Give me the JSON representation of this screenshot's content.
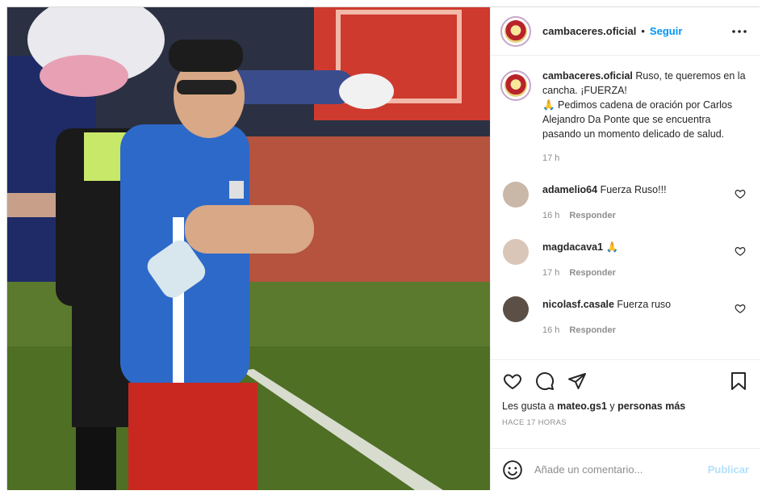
{
  "post": {
    "username": "cambaceres.oficial",
    "separator": "•",
    "follow_label": "Seguir",
    "caption_line1": " Ruso, te queremos en la cancha. ¡FUERZA!",
    "caption_line2": "🙏 Pedimos cadena de oración por Carlos Alejandro Da Ponte que se encuentra pasando un momento delicado de salud.",
    "caption_time": "17 h"
  },
  "comments": [
    {
      "username": "adamelio64",
      "text": " Fuerza Ruso!!!",
      "time": "16 h",
      "reply": "Responder"
    },
    {
      "username": "magdacava1",
      "text": " 🙏",
      "time": "17 h",
      "reply": "Responder"
    },
    {
      "username": "nicolasf.casale",
      "text": " Fuerza ruso",
      "time": "16 h",
      "reply": "Responder"
    }
  ],
  "likes": {
    "prefix": "Les gusta a ",
    "user": "mateo.gs1",
    "middle": " y ",
    "others": "personas más"
  },
  "date_label": "HACE 17 HORAS",
  "add_comment": {
    "placeholder": "Añade un comentario...",
    "publish_label": "Publicar"
  },
  "icons": {
    "more": "more-horizontal-icon",
    "like": "heart-icon",
    "comment": "comment-bubble-icon",
    "share": "paper-plane-icon",
    "save": "bookmark-icon",
    "emoji": "smiley-icon"
  },
  "colors": {
    "accent": "#0095f6",
    "publish_disabled": "#b2dffc",
    "muted": "#8e8e8e"
  }
}
